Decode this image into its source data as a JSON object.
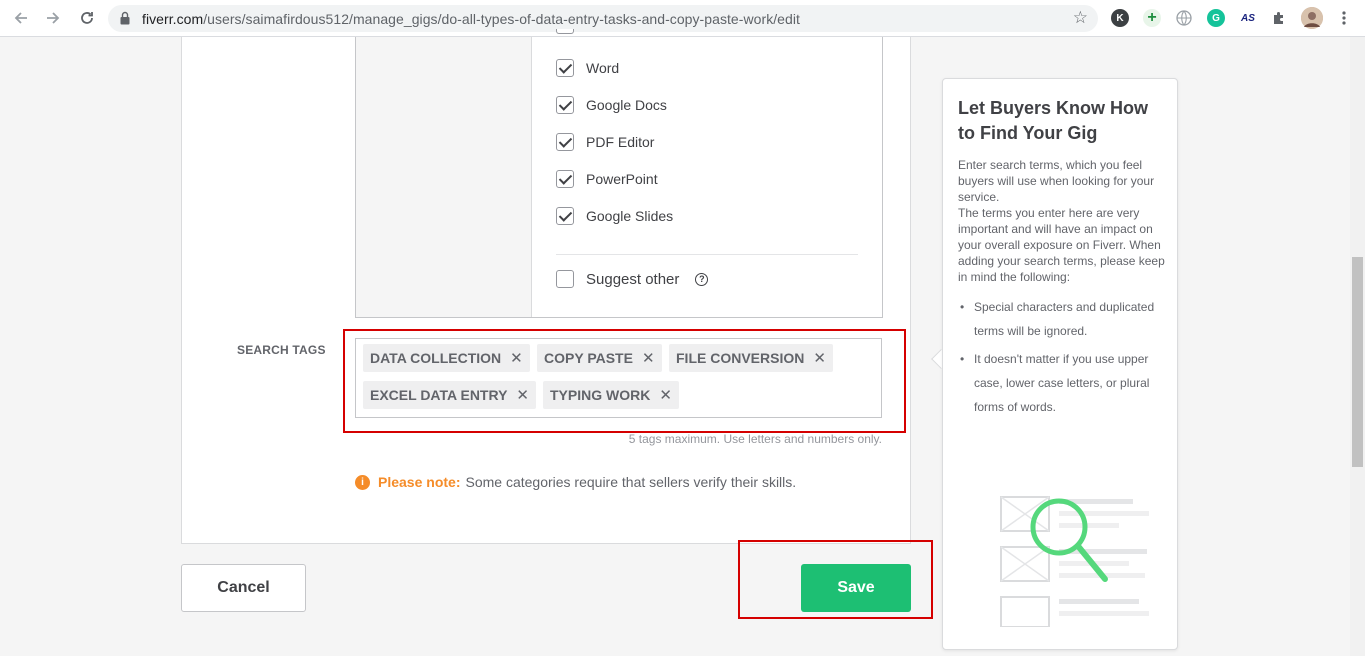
{
  "browser": {
    "url_host": "fiverr.com",
    "url_path": "/users/saimafirdous512/manage_gigs/do-all-types-of-data-entry-tasks-and-copy-paste-work/edit",
    "extensions": [
      {
        "name": "k-extension-icon",
        "label": "K",
        "color": "#3c4043"
      },
      {
        "name": "add-extension-icon",
        "label": "+",
        "color": "#1e8e3e"
      },
      {
        "name": "globe-icon",
        "label": "",
        "color": "#9aa0a6"
      },
      {
        "name": "grammarly-icon",
        "label": "G",
        "color": "#15c39a"
      },
      {
        "name": "as-extension-icon",
        "label": "AS",
        "color": "#1a237e"
      },
      {
        "name": "puzzle-icon",
        "label": "",
        "color": "#5f6368"
      }
    ]
  },
  "tools": {
    "items": [
      {
        "label": "Word",
        "checked": true
      },
      {
        "label": "Google Docs",
        "checked": true
      },
      {
        "label": "PDF Editor",
        "checked": true
      },
      {
        "label": "PowerPoint",
        "checked": true
      },
      {
        "label": "Google Slides",
        "checked": true
      }
    ],
    "suggest_other": "Suggest other"
  },
  "search_tags": {
    "label": "SEARCH TAGS",
    "tags": [
      "DATA COLLECTION",
      "COPY PASTE",
      "FILE CONVERSION",
      "EXCEL DATA ENTRY",
      "TYPING WORK"
    ],
    "hint": "5 tags maximum. Use letters and numbers only."
  },
  "note": {
    "strong": "Please note:",
    "text": "Some categories require that sellers verify their skills."
  },
  "actions": {
    "cancel_label": "Cancel",
    "save_label": "Save"
  },
  "tip": {
    "title": "Let Buyers Know How to Find Your Gig",
    "body_1": "Enter search terms, which you feel buyers will use when looking for your service.",
    "body_2": "The terms you enter here are very important and will have an impact on your overall exposure on Fiverr. When adding your search terms, please keep in mind the following:",
    "bullets": [
      "Special characters and duplicated terms will be ignored.",
      "It doesn't matter if you use upper case, lower case letters, or plural forms of words."
    ]
  },
  "colors": {
    "brand_green": "#1dbf73",
    "note_orange": "#f58c29",
    "highlight_red": "#d50000"
  }
}
